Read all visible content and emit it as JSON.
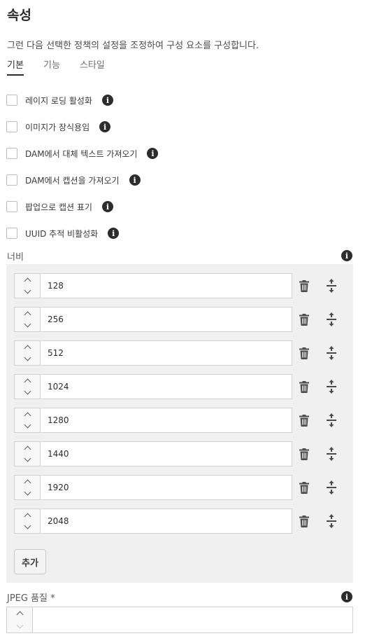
{
  "header": {
    "title": "속성",
    "description": "그런 다음 선택한 정책의 설정을 조정하여 구성 요소를 구성합니다."
  },
  "tabs": [
    {
      "label": "기본",
      "active": true
    },
    {
      "label": "기능",
      "active": false
    },
    {
      "label": "스타일",
      "active": false
    }
  ],
  "checkboxes": [
    {
      "label": "레이지 로딩 활성화",
      "checked": false
    },
    {
      "label": "이미지가 장식용임",
      "checked": false
    },
    {
      "label": "DAM에서 대체 텍스트 가져오기",
      "checked": false
    },
    {
      "label": "DAM에서 캡션을 가져오기",
      "checked": false
    },
    {
      "label": "팝업으로 캡션 표기",
      "checked": false
    },
    {
      "label": "UUID 추적 비활성화",
      "checked": false
    }
  ],
  "widths": {
    "label": "너비",
    "values": [
      "128",
      "256",
      "512",
      "1024",
      "1280",
      "1440",
      "1920",
      "2048"
    ],
    "add_label": "추가"
  },
  "jpeg_quality": {
    "label": "JPEG 품질 *",
    "value": ""
  },
  "icons": {
    "info": "info-icon",
    "trash": "trash-icon",
    "move": "move-handle-icon"
  }
}
